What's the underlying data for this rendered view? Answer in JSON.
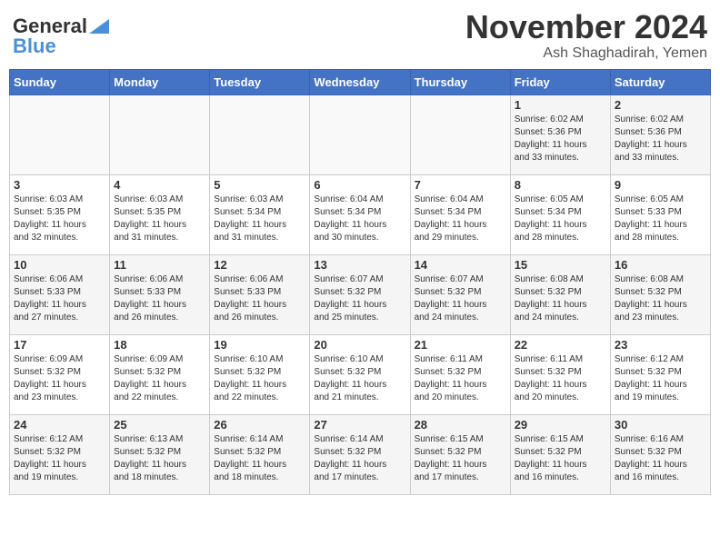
{
  "header": {
    "logo_line1": "General",
    "logo_line2": "Blue",
    "month_title": "November 2024",
    "location": "Ash Shaghadirah, Yemen"
  },
  "weekdays": [
    "Sunday",
    "Monday",
    "Tuesday",
    "Wednesday",
    "Thursday",
    "Friday",
    "Saturday"
  ],
  "weeks": [
    [
      {
        "day": "",
        "info": ""
      },
      {
        "day": "",
        "info": ""
      },
      {
        "day": "",
        "info": ""
      },
      {
        "day": "",
        "info": ""
      },
      {
        "day": "",
        "info": ""
      },
      {
        "day": "1",
        "info": "Sunrise: 6:02 AM\nSunset: 5:36 PM\nDaylight: 11 hours\nand 33 minutes."
      },
      {
        "day": "2",
        "info": "Sunrise: 6:02 AM\nSunset: 5:36 PM\nDaylight: 11 hours\nand 33 minutes."
      }
    ],
    [
      {
        "day": "3",
        "info": "Sunrise: 6:03 AM\nSunset: 5:35 PM\nDaylight: 11 hours\nand 32 minutes."
      },
      {
        "day": "4",
        "info": "Sunrise: 6:03 AM\nSunset: 5:35 PM\nDaylight: 11 hours\nand 31 minutes."
      },
      {
        "day": "5",
        "info": "Sunrise: 6:03 AM\nSunset: 5:34 PM\nDaylight: 11 hours\nand 31 minutes."
      },
      {
        "day": "6",
        "info": "Sunrise: 6:04 AM\nSunset: 5:34 PM\nDaylight: 11 hours\nand 30 minutes."
      },
      {
        "day": "7",
        "info": "Sunrise: 6:04 AM\nSunset: 5:34 PM\nDaylight: 11 hours\nand 29 minutes."
      },
      {
        "day": "8",
        "info": "Sunrise: 6:05 AM\nSunset: 5:34 PM\nDaylight: 11 hours\nand 28 minutes."
      },
      {
        "day": "9",
        "info": "Sunrise: 6:05 AM\nSunset: 5:33 PM\nDaylight: 11 hours\nand 28 minutes."
      }
    ],
    [
      {
        "day": "10",
        "info": "Sunrise: 6:06 AM\nSunset: 5:33 PM\nDaylight: 11 hours\nand 27 minutes."
      },
      {
        "day": "11",
        "info": "Sunrise: 6:06 AM\nSunset: 5:33 PM\nDaylight: 11 hours\nand 26 minutes."
      },
      {
        "day": "12",
        "info": "Sunrise: 6:06 AM\nSunset: 5:33 PM\nDaylight: 11 hours\nand 26 minutes."
      },
      {
        "day": "13",
        "info": "Sunrise: 6:07 AM\nSunset: 5:32 PM\nDaylight: 11 hours\nand 25 minutes."
      },
      {
        "day": "14",
        "info": "Sunrise: 6:07 AM\nSunset: 5:32 PM\nDaylight: 11 hours\nand 24 minutes."
      },
      {
        "day": "15",
        "info": "Sunrise: 6:08 AM\nSunset: 5:32 PM\nDaylight: 11 hours\nand 24 minutes."
      },
      {
        "day": "16",
        "info": "Sunrise: 6:08 AM\nSunset: 5:32 PM\nDaylight: 11 hours\nand 23 minutes."
      }
    ],
    [
      {
        "day": "17",
        "info": "Sunrise: 6:09 AM\nSunset: 5:32 PM\nDaylight: 11 hours\nand 23 minutes."
      },
      {
        "day": "18",
        "info": "Sunrise: 6:09 AM\nSunset: 5:32 PM\nDaylight: 11 hours\nand 22 minutes."
      },
      {
        "day": "19",
        "info": "Sunrise: 6:10 AM\nSunset: 5:32 PM\nDaylight: 11 hours\nand 22 minutes."
      },
      {
        "day": "20",
        "info": "Sunrise: 6:10 AM\nSunset: 5:32 PM\nDaylight: 11 hours\nand 21 minutes."
      },
      {
        "day": "21",
        "info": "Sunrise: 6:11 AM\nSunset: 5:32 PM\nDaylight: 11 hours\nand 20 minutes."
      },
      {
        "day": "22",
        "info": "Sunrise: 6:11 AM\nSunset: 5:32 PM\nDaylight: 11 hours\nand 20 minutes."
      },
      {
        "day": "23",
        "info": "Sunrise: 6:12 AM\nSunset: 5:32 PM\nDaylight: 11 hours\nand 19 minutes."
      }
    ],
    [
      {
        "day": "24",
        "info": "Sunrise: 6:12 AM\nSunset: 5:32 PM\nDaylight: 11 hours\nand 19 minutes."
      },
      {
        "day": "25",
        "info": "Sunrise: 6:13 AM\nSunset: 5:32 PM\nDaylight: 11 hours\nand 18 minutes."
      },
      {
        "day": "26",
        "info": "Sunrise: 6:14 AM\nSunset: 5:32 PM\nDaylight: 11 hours\nand 18 minutes."
      },
      {
        "day": "27",
        "info": "Sunrise: 6:14 AM\nSunset: 5:32 PM\nDaylight: 11 hours\nand 17 minutes."
      },
      {
        "day": "28",
        "info": "Sunrise: 6:15 AM\nSunset: 5:32 PM\nDaylight: 11 hours\nand 17 minutes."
      },
      {
        "day": "29",
        "info": "Sunrise: 6:15 AM\nSunset: 5:32 PM\nDaylight: 11 hours\nand 16 minutes."
      },
      {
        "day": "30",
        "info": "Sunrise: 6:16 AM\nSunset: 5:32 PM\nDaylight: 11 hours\nand 16 minutes."
      }
    ]
  ]
}
